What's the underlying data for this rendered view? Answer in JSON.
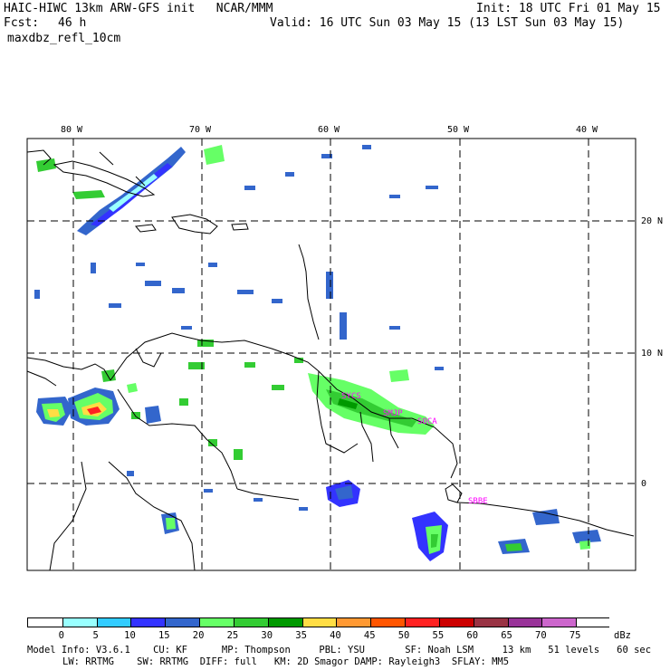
{
  "header": {
    "title_line1": "HAIC-HIWC 13km ARW-GFS init   NCAR/MMM",
    "init": "Init: 18 UTC Fri 01 May 15",
    "fcst_label": "Fcst:",
    "fcst_value": "46 h",
    "valid": "Valid: 16 UTC Sun 03 May 15 (13 LST Sun 03 May 15)",
    "field": "maxdbz_refl_10cm"
  },
  "map": {
    "lon_labels": [
      "80 W",
      "70 W",
      "60 W",
      "50 W",
      "40 W"
    ],
    "lat_labels": [
      "20 N",
      "10 N",
      "0"
    ],
    "stations": [
      "SYCS",
      "SMJP",
      "SOCA",
      "SBBE"
    ],
    "station_color": "#ff00ff",
    "grid_color": "#000000"
  },
  "colorbar": {
    "colors": [
      "#ffffff",
      "#99ffff",
      "#33ccff",
      "#3333ff",
      "#3366cc",
      "#66ff66",
      "#33cc33",
      "#009900",
      "#ffdd44",
      "#ff9933",
      "#ff5500",
      "#ff2222",
      "#cc0000",
      "#993344",
      "#993399",
      "#cc66cc",
      "#ffffff"
    ],
    "labels": [
      "0",
      "5",
      "10",
      "15",
      "20",
      "25",
      "30",
      "35",
      "40",
      "45",
      "50",
      "55",
      "60",
      "65",
      "70",
      "75"
    ],
    "unit": "dBz"
  },
  "footer": {
    "line1": "Model Info: V3.6.1    CU: KF      MP: Thompson     PBL: YSU       SF: Noah LSM     13 km   51 levels   60 sec",
    "line2": "LW: RRTMG    SW: RRTMG  DIFF: full   KM: 2D Smagor DAMP: Rayleigh3  SFLAY: MM5"
  }
}
